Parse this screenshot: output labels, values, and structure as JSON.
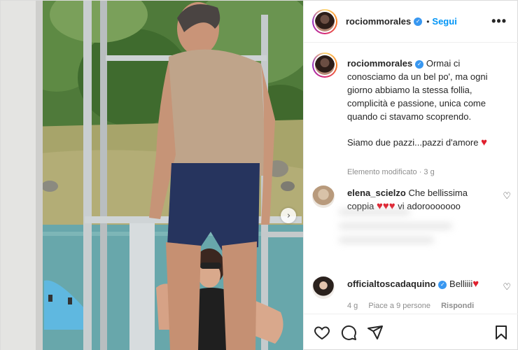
{
  "post": {
    "author": {
      "username": "rociommorales",
      "verified_icon": "verified-badge-icon",
      "separator": "•",
      "follow_label": "Segui",
      "more_label": "•••"
    },
    "caption": {
      "username": "rociommorales",
      "text_1": "Ormai ci conosciamo da un bel po', ma ogni giorno abbiamo la stessa follia, complicità e passione, unica come quando ci stavamo scoprendo.",
      "text_2": "Siamo due pazzi...pazzi d'amore",
      "heart": "♥",
      "meta": "Elemento modificato · 3 g"
    },
    "comments": [
      {
        "username": "elena_scielzo",
        "text": "Che bellissima coppia",
        "hearts": "♥♥♥",
        "text_after": "vi adorooooooo",
        "like_icon": "♡"
      },
      {
        "username": "officialtoscadaquino",
        "text": "Belliiii",
        "hearts": "♥",
        "like_icon": "♡",
        "time": "4 g",
        "likes": "Piace a 9 persone",
        "reply_label": "Rispondi"
      }
    ],
    "carousel_next_icon": "›",
    "actions": [
      "heart-icon",
      "comment-icon",
      "share-icon",
      "bookmark-icon"
    ],
    "colors": {
      "accent": "#0095f6",
      "verified": "#3897f0",
      "heart": "#e0202e",
      "muted": "#8e8e8e",
      "text": "#262626"
    }
  }
}
